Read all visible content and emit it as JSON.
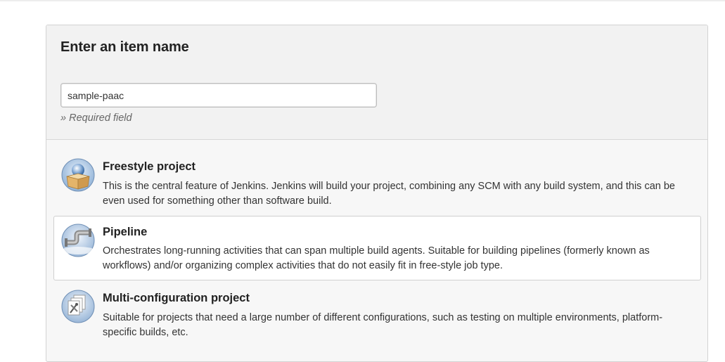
{
  "form": {
    "title": "Enter an item name",
    "item_name_value": "sample-paac",
    "required_note": "» Required field"
  },
  "item_types": [
    {
      "name": "Freestyle project",
      "description": "This is the central feature of Jenkins. Jenkins will build your project, combining any SCM with any build system, and this can be even used for something other than software build.",
      "icon": "freestyle-box-icon",
      "selected": false
    },
    {
      "name": "Pipeline",
      "description": "Orchestrates long-running activities that can span multiple build agents. Suitable for building pipelines (formerly known as workflows) and/or organizing complex activities that do not easily fit in free-style job type.",
      "icon": "pipeline-pipe-icon",
      "selected": true
    },
    {
      "name": "Multi-configuration project",
      "description": "Suitable for projects that need a large number of different configurations, such as testing on multiple environments, platform-specific builds, etc.",
      "icon": "multi-config-icon",
      "selected": false
    }
  ],
  "colors": {
    "panel_bg": "#f7f7f7",
    "header_bg": "#f2f2f2",
    "selected_bg": "#ffffff",
    "border": "#d3d3d3"
  }
}
